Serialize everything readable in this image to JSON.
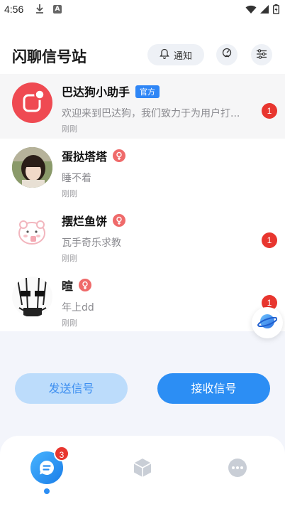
{
  "status_bar": {
    "time": "4:56",
    "download_icon": "download-icon",
    "a_icon": "A"
  },
  "header": {
    "title": "闪聊信号站",
    "notify_label": "通知"
  },
  "messages": [
    {
      "name": "巴达狗小助手",
      "tag": "官方",
      "preview": "欢迎来到巴达狗，我们致力于为用户打...",
      "time": "刚刚",
      "unread": "1"
    },
    {
      "name": "蛋挞塔塔",
      "preview": "睡不着",
      "time": "刚刚",
      "unread": ""
    },
    {
      "name": "摆烂鱼饼",
      "preview": "瓦手奇乐求教",
      "time": "刚刚",
      "unread": "1"
    },
    {
      "name": "暄",
      "preview": "年上dd",
      "time": "刚刚",
      "unread": "1"
    }
  ],
  "actions": {
    "send": "发送信号",
    "receive": "接收信号"
  },
  "tabbar": {
    "messages_badge": "3"
  },
  "colors": {
    "accent": "#2c8ef4",
    "badge": "#e8362f",
    "official": "#2f86f6"
  }
}
